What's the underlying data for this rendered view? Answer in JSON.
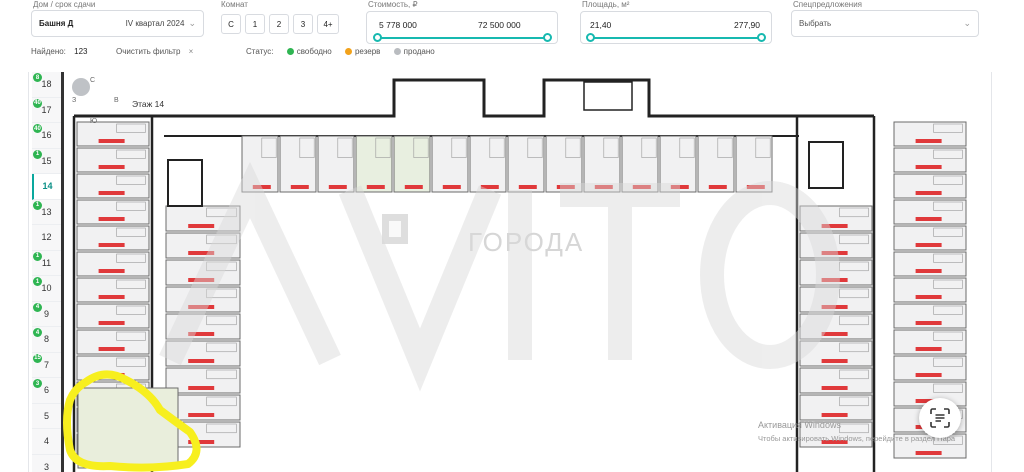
{
  "filters": {
    "house": {
      "label": "Дом / срок сдачи",
      "building": "Башня Д",
      "quarter": "IV квартал 2024"
    },
    "rooms": {
      "label": "Комнат",
      "options": [
        "С",
        "1",
        "2",
        "3",
        "4+"
      ]
    },
    "price": {
      "label": "Стоимость, ₽",
      "min": "5 778 000",
      "max": "72 500 000"
    },
    "area": {
      "label": "Площадь, м²",
      "min": "21,40",
      "max": "277,90"
    },
    "special": {
      "label": "Спецпредложения",
      "placeholder": "Выбрать"
    }
  },
  "summary": {
    "found_label": "Найдено:",
    "found_count": "123",
    "clear_label": "Очистить фильтр",
    "clear_icon": "×"
  },
  "status": {
    "label": "Статус:",
    "items": [
      {
        "label": "свободно",
        "color": "#2fb552"
      },
      {
        "label": "резерв",
        "color": "#f2a21b"
      },
      {
        "label": "продано",
        "color": "#b9bcc0"
      }
    ]
  },
  "floors": [
    {
      "num": "18",
      "count": "8"
    },
    {
      "num": "17",
      "count": "40"
    },
    {
      "num": "16",
      "count": "40"
    },
    {
      "num": "15",
      "count": "1"
    },
    {
      "num": "14",
      "count": "",
      "active": true
    },
    {
      "num": "13",
      "count": "1"
    },
    {
      "num": "12",
      "count": ""
    },
    {
      "num": "11",
      "count": "1"
    },
    {
      "num": "10",
      "count": "1"
    },
    {
      "num": "9",
      "count": "4"
    },
    {
      "num": "8",
      "count": "4"
    },
    {
      "num": "7",
      "count": "15"
    },
    {
      "num": "6",
      "count": "3"
    },
    {
      "num": "5",
      "count": ""
    },
    {
      "num": "4",
      "count": ""
    },
    {
      "num": "3",
      "count": ""
    }
  ],
  "compass": {
    "north": "С",
    "west": "З",
    "east": "В",
    "south": "Ю"
  },
  "floor_title": "Этаж 14",
  "watermark": "ГОРОДА",
  "os_notice": {
    "line1": "Активация Windows",
    "line2": "Чтобы активировать Windows, перейдите в раздел Пара"
  },
  "colors": {
    "accent": "#17b9b0",
    "free": "#2fb552",
    "reserve": "#f2a21b",
    "sold": "#b9bcc0",
    "highlight": "#f7ef1e",
    "apt_label": "#e0393b"
  }
}
